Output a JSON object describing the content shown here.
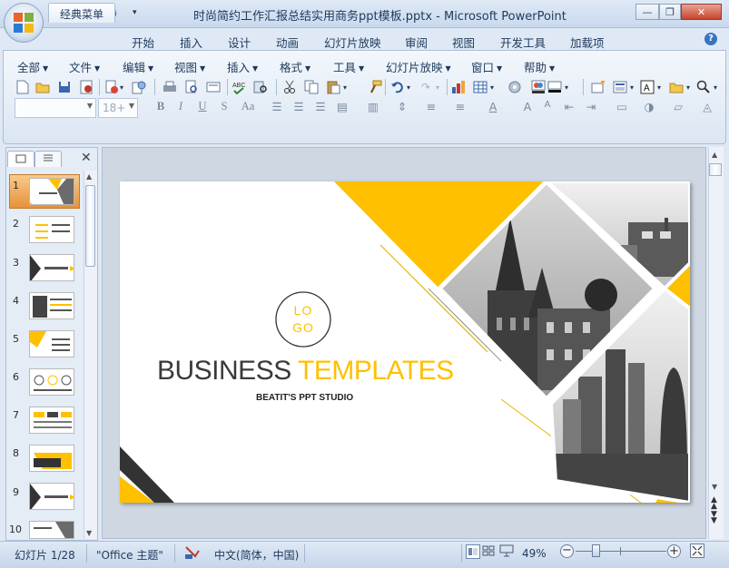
{
  "window": {
    "title": "时尚简约工作汇报总结实用商务ppt模板.pptx - Microsoft PowerPoint",
    "minimize": "—",
    "restore": "❐",
    "close": "✕"
  },
  "tabs": [
    "经典菜单",
    "开始",
    "插入",
    "设计",
    "动画",
    "幻灯片放映",
    "审阅",
    "视图",
    "开发工具",
    "加载项"
  ],
  "help": "?",
  "menu": [
    "全部",
    "文件",
    "编辑",
    "视图",
    "插入",
    "格式",
    "工具",
    "幻灯片放映",
    "窗口",
    "帮助"
  ],
  "format": {
    "font_name": "",
    "font_size": "18+"
  },
  "outline": {
    "close": "✕",
    "slides": [
      "1",
      "2",
      "3",
      "4",
      "5",
      "6",
      "7",
      "8",
      "9",
      "10"
    ]
  },
  "slide": {
    "logo_line1": "LO",
    "logo_line2": "GO",
    "title_dark": "BUSINESS",
    "title_accent": "TEMPLATES",
    "subtitle": "BEATIT'S PPT STUDIO"
  },
  "status": {
    "slide_info": "幻灯片 1/28",
    "theme": "\"Office 主题\"",
    "language": "中文(简体，中国)",
    "zoom": "49%"
  },
  "colors": {
    "accent": "#ffc000",
    "ribbon_bg": "#dfe9f5"
  }
}
